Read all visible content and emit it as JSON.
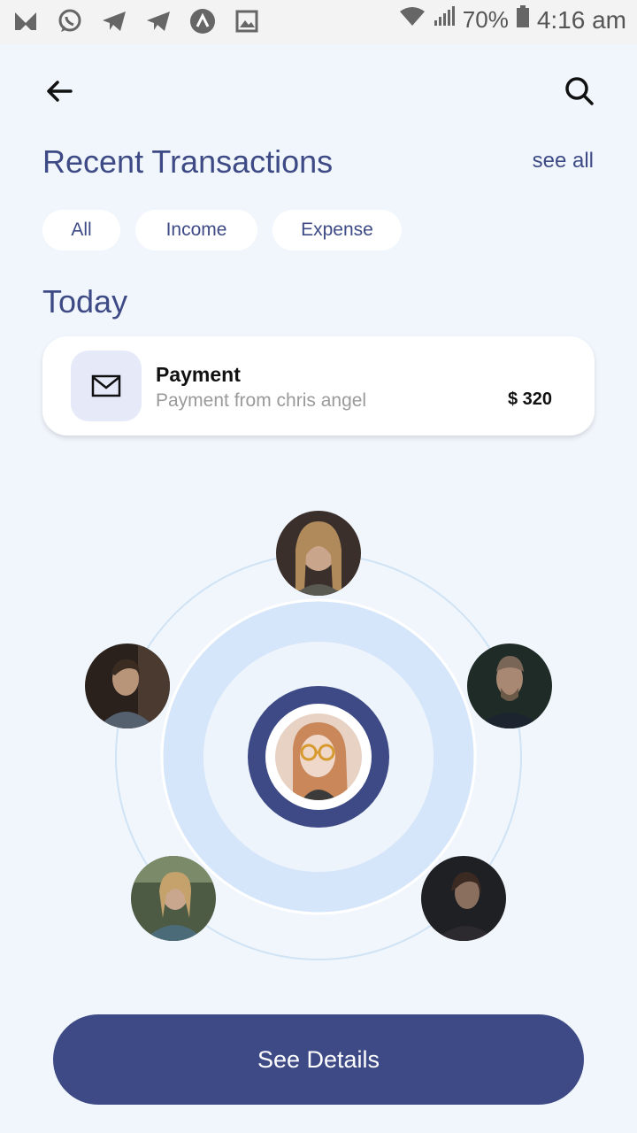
{
  "status_bar": {
    "battery_pct": "70%",
    "time": "4:16 am",
    "icons": [
      "m-app-icon",
      "whatsapp-icon",
      "telegram-icon",
      "telegram-icon",
      "app-a-icon",
      "image-icon",
      "wifi-icon",
      "signal-icon",
      "battery-icon"
    ]
  },
  "header": {
    "back_icon": "arrow-left-icon",
    "search_icon": "search-icon"
  },
  "title": "Recent Transactions",
  "see_all": "see all",
  "filters": [
    {
      "label": "All"
    },
    {
      "label": "Income"
    },
    {
      "label": "Expense"
    }
  ],
  "section_title": "Today",
  "transaction": {
    "icon": "mail-icon",
    "title": "Payment",
    "subtitle": "Payment from chris angel",
    "amount": "$ 320"
  },
  "contacts": {
    "center_avatar": "user-avatar-center",
    "orbit_avatars": [
      "avatar-1",
      "avatar-2",
      "avatar-3",
      "avatar-4",
      "avatar-5"
    ]
  },
  "cta_label": "See Details",
  "colors": {
    "primary": "#3d4a85",
    "background": "#f1f6fc",
    "ring_light": "#d6e6fa",
    "chip_bg": "#ffffff",
    "muted_text": "#9a9a9a"
  }
}
